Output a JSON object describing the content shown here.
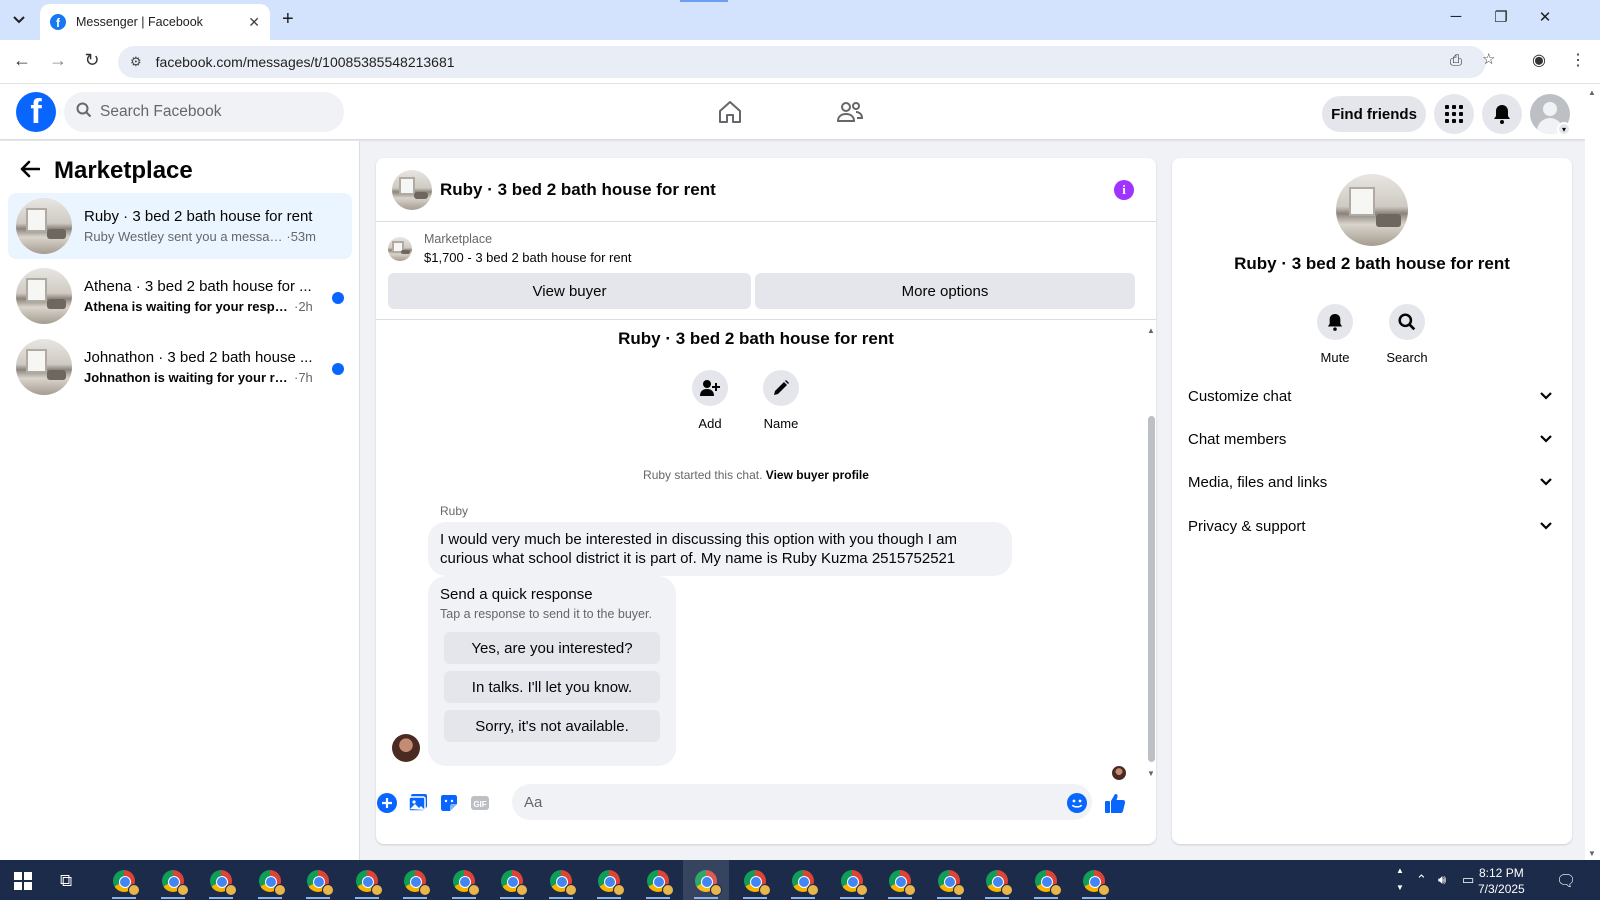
{
  "browser": {
    "tab_title": "Messenger | Facebook",
    "url": "facebook.com/messages/t/10085385548213681",
    "tab_list_icon": "chevron-down-icon",
    "new_tab_icon": "plus-icon"
  },
  "fb_header": {
    "search_placeholder": "Search Facebook",
    "find_friends_label": "Find friends"
  },
  "sidebar": {
    "title": "Marketplace",
    "conversations": [
      {
        "name": "Ruby · 3 bed 2 bath house for rent",
        "preview": "Ruby Westley sent you a message a...",
        "time": " ·53m",
        "unread": false,
        "active": true
      },
      {
        "name": "Athena · 3 bed 2 bath house for ...",
        "preview": "Athena is waiting for your response.",
        "time": " ·2h",
        "unread": true,
        "active": false
      },
      {
        "name": "Johnathon · 3 bed 2 bath house ...",
        "preview": "Johnathon is waiting for your resp...",
        "time": " ·7h",
        "unread": true,
        "active": false
      }
    ]
  },
  "chat": {
    "title": "Ruby · 3 bed 2 bath house for rent",
    "marketplace_label": "Marketplace",
    "listing": "$1,700 - 3 bed 2 bath house for rent",
    "view_buyer_label": "View buyer",
    "more_options_label": "More options",
    "intro_title": "Ruby · 3 bed 2 bath house for rent",
    "add_label": "Add",
    "name_label": "Name",
    "started_text": "Ruby started this chat.",
    "view_buyer_profile": "View buyer profile",
    "sender": "Ruby",
    "message": "I would very much be interested in discussing this option with you though I am curious what school district it is part of. My name is Ruby Kuzma 2515752521",
    "quick_response_title": "Send a quick response",
    "quick_response_sub": "Tap a response to send it to the buyer.",
    "quick_responses": [
      "Yes, are you interested?",
      "In talks. I'll let you know.",
      "Sorry, it's not available."
    ],
    "composer_placeholder": "Aa"
  },
  "info_panel": {
    "title": "Ruby · 3 bed 2 bath house for rent",
    "mute_label": "Mute",
    "search_label": "Search",
    "sections": [
      "Customize chat",
      "Chat members",
      "Media, files and links",
      "Privacy & support"
    ]
  },
  "taskbar": {
    "time": "8:12 PM",
    "date": "7/3/2025",
    "chrome_count": 21
  },
  "colors": {
    "fb_blue": "#0866ff",
    "active_conv_bg": "#ebf5ff",
    "info_purple": "#a033ff",
    "taskbar_bg": "#1c2b4a"
  }
}
